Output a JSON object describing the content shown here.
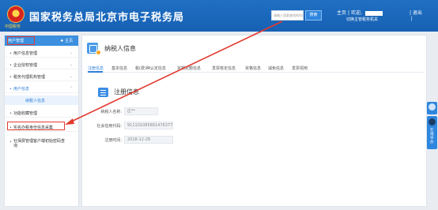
{
  "header": {
    "title": "国家税务总局北京市电子税务局",
    "emblem_text": "中国税务",
    "search_placeholder": "请输入您要查找的内容",
    "search_button": "搜索",
    "home": "主页",
    "welcome": "| 欢迎,",
    "switch_taxpayer": "切换主管税务机关",
    "logout": "| 退出",
    "logout_tail": "|"
  },
  "sidebar": {
    "head_label": "用户管理",
    "home_label": "♠ 主页",
    "items": [
      {
        "label": "用户信息管理",
        "chev": "⌄"
      },
      {
        "label": "企业授权管理",
        "chev": "⌄"
      },
      {
        "label": "税务代理机构管理",
        "chev": "⌄"
      },
      {
        "label": "用户信息",
        "chev": "⌃"
      },
      {
        "label": "纳税人信息"
      },
      {
        "label": "功能收藏管理"
      },
      {
        "label": "实名办税身份信息采集"
      },
      {
        "label": "社保费管理客户端初始密码查询"
      }
    ]
  },
  "main": {
    "title": "纳税人信息",
    "tabs": [
      "注册信息",
      "基本信息",
      "税(费)种认定信息",
      "定期定额信息",
      "发票核定信息",
      "资格信息",
      "减免信息",
      "发票领用"
    ],
    "section_title": "注册信息",
    "fields": [
      {
        "label": "纳税人名称:",
        "value": "庄**"
      },
      {
        "label": "社会信用代码:",
        "value": "9111010858914763​77"
      },
      {
        "label": "注册时间:",
        "value": "2018-12-28"
      }
    ]
  },
  "float": {
    "service_text": "在线导办"
  },
  "colors": {
    "header_blue": "#1761b4",
    "accent": "#2f7fd8",
    "annotation_red": "#e23a2f"
  }
}
